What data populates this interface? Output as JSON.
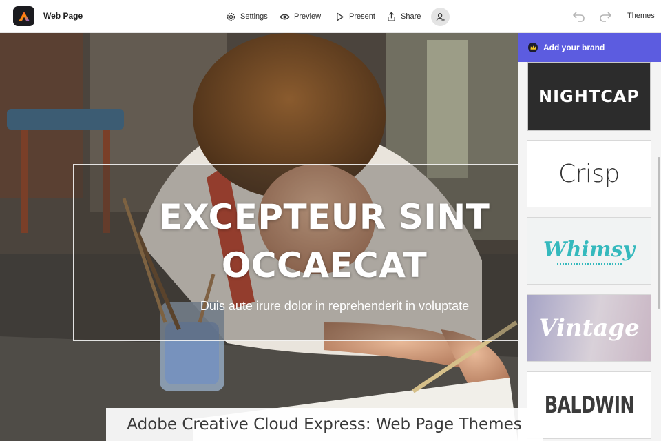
{
  "app": {
    "logo_icon": "creative-cloud-express-logo",
    "doc_title": "Web Page"
  },
  "toolbar": {
    "settings_label": "Settings",
    "preview_label": "Preview",
    "present_label": "Present",
    "share_label": "Share",
    "themes_label": "Themes"
  },
  "hero": {
    "title_line1": "EXCEPTEUR SINT",
    "title_line2": "OCCAECAT",
    "subtitle": "Duis aute irure dolor in reprehenderit in voluptate"
  },
  "panel": {
    "brand_label": "Add your brand",
    "themes": [
      {
        "name": "NIGHTCAP"
      },
      {
        "name": "Crisp"
      },
      {
        "name": "Whimsy"
      },
      {
        "name": "Vintage"
      },
      {
        "name": "BALDWIN"
      }
    ]
  },
  "caption": "Adobe Creative Cloud Express: Web Page Themes",
  "colors": {
    "brand_bar": "#5c5ce0",
    "whimsy_accent": "#35b9bd",
    "nightcap_bg": "#2c2c2c"
  }
}
